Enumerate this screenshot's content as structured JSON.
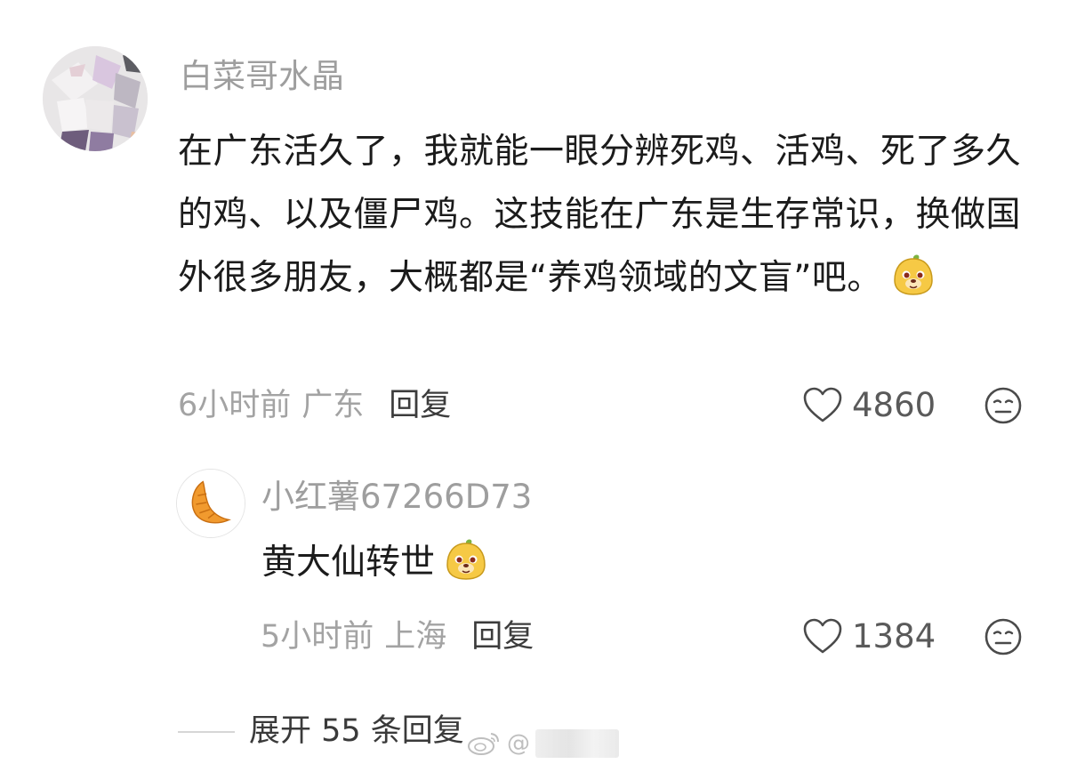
{
  "comment": {
    "username": "白菜哥水晶",
    "text": "在广东活久了，我就能一眼分辨死鸡、活鸡、死了多久的鸡、以及僵尸鸡。这技能在广东是生存常识，换做国外很多朋友，大概都是“养鸡领域的文盲”吧。",
    "emoji_icon": "dog-face-emoji-icon",
    "time": "6小时前",
    "location": "广东",
    "reply_label": "回复",
    "likes": "4860"
  },
  "reply": {
    "username": "小红薯67266D73",
    "text": "黄大仙转世",
    "emoji_icon": "dog-face-emoji-icon",
    "time": "5小时前",
    "location": "上海",
    "reply_label": "回复",
    "likes": "1384"
  },
  "expand": {
    "label": "展开 55 条回复"
  },
  "watermark": {
    "at": "@"
  },
  "colors": {
    "username": "#9e9e9e",
    "text": "#1b1b1b",
    "meta": "#a3a3a3",
    "action": "#3c3c3c"
  }
}
